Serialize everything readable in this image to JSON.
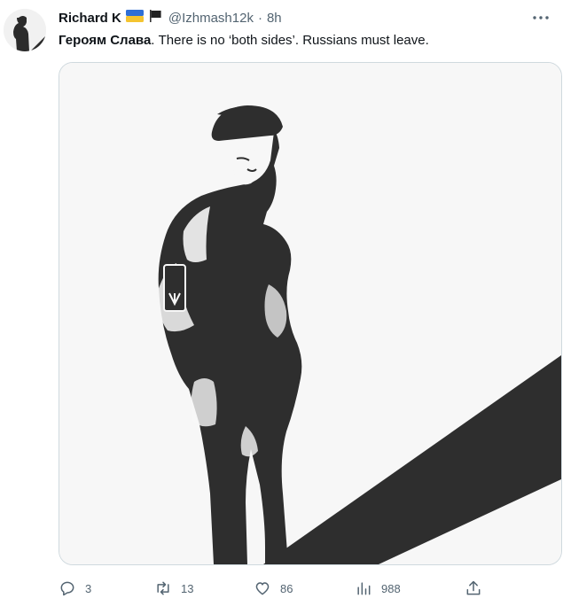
{
  "author": {
    "display_name": "Richard K",
    "flags": [
      "ukraine-flag",
      "black-flag"
    ],
    "handle": "@Izhmash12k",
    "separator": "·",
    "time": "8h"
  },
  "tweet": {
    "bold_text": "Героям Слава",
    "text": ". There is no ‘both sides’. Russians must leave."
  },
  "media": {
    "image": "illustration-soldier-silhouette",
    "colors": {
      "ink": "#2e2e2e",
      "background": "#f7f7f7"
    }
  },
  "actions": {
    "reply_count": "3",
    "repost_count": "13",
    "like_count": "86",
    "view_count": "988"
  },
  "colors": {
    "text": "#0f1419",
    "muted": "#536471",
    "border": "#cfd9de"
  }
}
